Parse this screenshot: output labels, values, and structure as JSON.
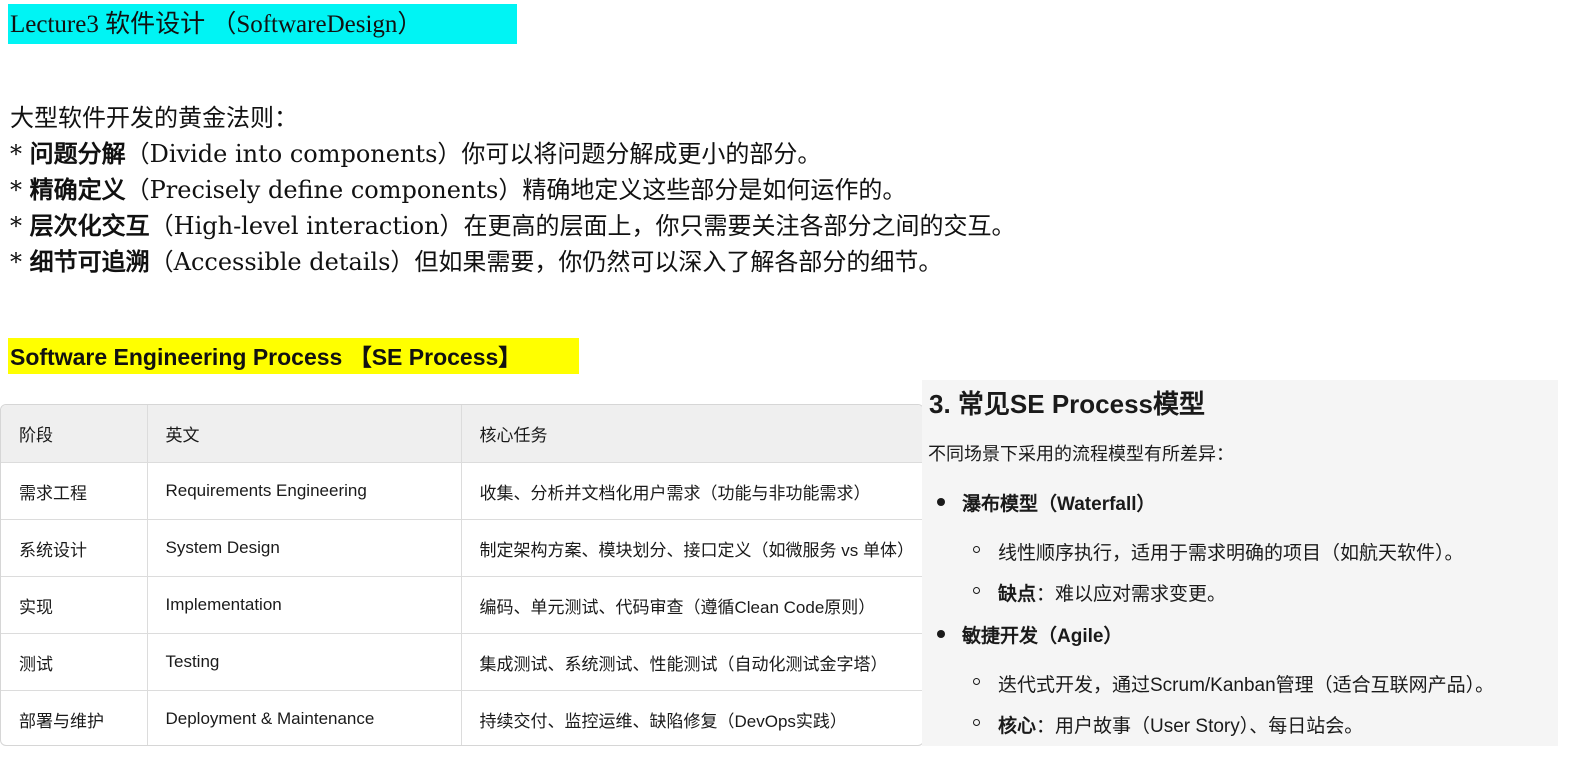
{
  "title": "Lecture3 软件设计 （SoftwareDesign）",
  "rules": {
    "heading": "大型软件开发的黄金法则：",
    "items": [
      {
        "bullet": "* ",
        "bold": "问题分解",
        "rest": "（Divide into components）你可以将问题分解成更小的部分。"
      },
      {
        "bullet": "* ",
        "bold": "精确定义",
        "rest": "（Precisely define components）精确地定义这些部分是如何运作的。"
      },
      {
        "bullet": "* ",
        "bold": "层次化交互",
        "rest": "（High-level interaction）在更高的层面上，你只需要关注各部分之间的交互。"
      },
      {
        "bullet": "* ",
        "bold": "细节可追溯",
        "rest": "（Accessible details）但如果需要，你仍然可以深入了解各部分的细节。"
      }
    ]
  },
  "se_heading": "Software Engineering Process 【SE Process】",
  "table": {
    "headers": [
      "阶段",
      "英文",
      "核心任务"
    ],
    "rows": [
      [
        "需求工程",
        "Requirements Engineering",
        "收集、分析并文档化用户需求（功能与非功能需求）"
      ],
      [
        "系统设计",
        "System Design",
        "制定架构方案、模块划分、接口定义（如微服务 vs 单体）"
      ],
      [
        "实现",
        "Implementation",
        "编码、单元测试、代码审查（遵循Clean Code原则）"
      ],
      [
        "测试",
        "Testing",
        "集成测试、系统测试、性能测试（自动化测试金字塔）"
      ],
      [
        "部署与维护",
        "Deployment & Maintenance",
        "持续交付、监控运维、缺陷修复（DevOps实践）"
      ]
    ]
  },
  "process_models": {
    "heading": "3. 常见SE Process模型",
    "intro": "不同场景下采用的流程模型有所差异：",
    "waterfall": {
      "title": "瀑布模型（Waterfall）",
      "sub1": "线性顺序执行，适用于需求明确的项目（如航天软件）。",
      "sub2_bold": "缺点",
      "sub2_rest": "：难以应对需求变更。"
    },
    "agile": {
      "title": "敏捷开发（Agile）",
      "sub1": "迭代式开发，通过Scrum/Kanban管理（适合互联网产品）。",
      "sub2_bold": "核心",
      "sub2_rest": "：用户故事（User Story）、每日站会。"
    }
  }
}
